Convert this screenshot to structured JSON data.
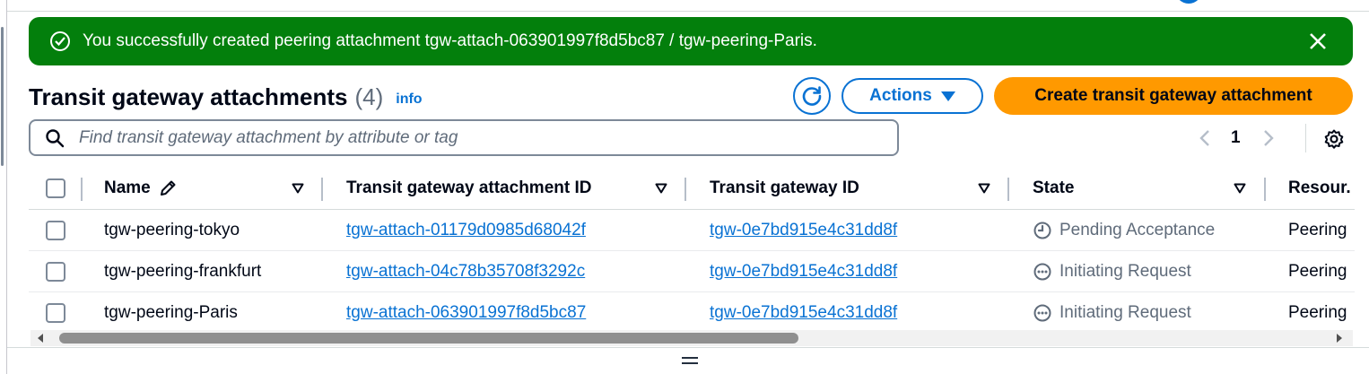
{
  "flash": {
    "message": "You successfully created peering attachment tgw-attach-063901997f8d5bc87 / tgw-peering-Paris.",
    "color": "#037f0c"
  },
  "header": {
    "title": "Transit gateway attachments",
    "count": "(4)",
    "info": "info",
    "actions_label": "Actions",
    "create_label": "Create transit gateway attachment"
  },
  "search": {
    "placeholder": "Find transit gateway attachment by attribute or tag",
    "value": ""
  },
  "pagination": {
    "current_page": "1"
  },
  "table": {
    "columns": {
      "name": "Name",
      "attachment_id": "Transit gateway attachment ID",
      "tgw_id": "Transit gateway ID",
      "state": "State",
      "resource": "Resour."
    },
    "rows": [
      {
        "name": "tgw-peering-tokyo",
        "attachment_id": "tgw-attach-01179d0985d68042f",
        "tgw_id": "tgw-0e7bd915e4c31dd8f",
        "state": "Pending Acceptance",
        "state_icon": "clock-icon",
        "resource": "Peering"
      },
      {
        "name": "tgw-peering-frankfurt",
        "attachment_id": "tgw-attach-04c78b35708f3292c",
        "tgw_id": "tgw-0e7bd915e4c31dd8f",
        "state": "Initiating Request",
        "state_icon": "ellipsis-circle-icon",
        "resource": "Peering"
      },
      {
        "name": "tgw-peering-Paris",
        "attachment_id": "tgw-attach-063901997f8d5bc87",
        "tgw_id": "tgw-0e7bd915e4c31dd8f",
        "state": "Initiating Request",
        "state_icon": "ellipsis-circle-icon",
        "resource": "Peering"
      }
    ]
  },
  "colors": {
    "link": "#0972d3",
    "primary_button": "#ff9900",
    "muted_text": "#5f6b7a"
  }
}
